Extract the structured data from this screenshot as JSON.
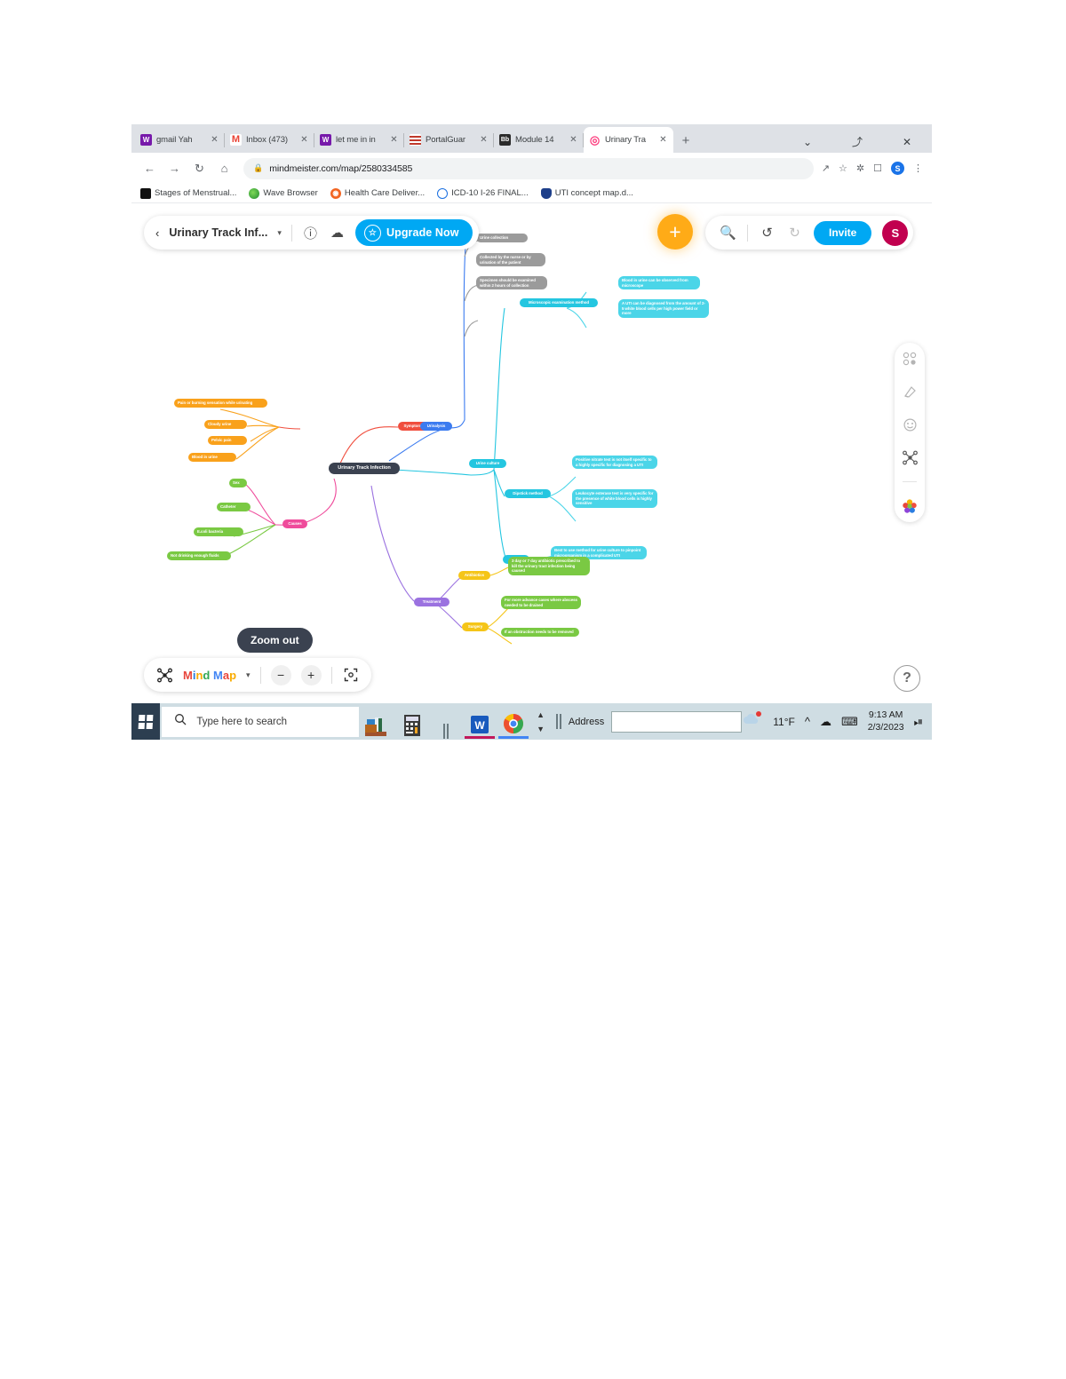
{
  "browser": {
    "tabs": [
      {
        "title": "gmail  Yah",
        "favicon": "w-icon",
        "active": false
      },
      {
        "title": "Inbox (473)",
        "favicon": "gmail-icon",
        "active": false
      },
      {
        "title": "let me in in",
        "favicon": "w-icon",
        "active": false
      },
      {
        "title": "PortalGuar",
        "favicon": "grid-icon",
        "active": false
      },
      {
        "title": "Module 14",
        "favicon": "blackboard-icon",
        "active": false
      },
      {
        "title": "Urinary Tra",
        "favicon": "mindmeister-icon",
        "active": true
      }
    ],
    "new_tab_label": "+",
    "tabstrip_buttons": [
      "⌄",
      "⤴",
      "✕"
    ],
    "omnibox": {
      "url": "mindmeister.com/map/2580334585",
      "lock_icon": "lock-icon",
      "back_icon": "←",
      "forward_icon": "→",
      "reload_icon": "↻",
      "home_icon": "⌂",
      "right_icons": [
        "share-icon",
        "star-icon",
        "extensions-icon",
        "sidepanel-icon"
      ],
      "profile_initial": "S",
      "menu_icon": "⋮"
    },
    "bookmarks": [
      {
        "label": "Stages of Menstrual...",
        "icon": "dark-icon"
      },
      {
        "label": "Wave Browser",
        "icon": "green-globe-icon"
      },
      {
        "label": "Health Care Deliver...",
        "icon": "orange-icon"
      },
      {
        "label": "ICD-10 I-26 FINAL...",
        "icon": "blue-icon"
      },
      {
        "label": "UTI concept map.d...",
        "icon": "shield-icon"
      }
    ]
  },
  "app": {
    "toolbar": {
      "back_icon": "‹",
      "map_title": "Urinary Track Inf...",
      "caret": "▾",
      "info_icon": "ⓘ",
      "export_icon": "export-cloud-icon",
      "upgrade_label": "Upgrade Now",
      "star_icon": "☆",
      "add_label": "+",
      "search_icon": "⚲",
      "undo_icon": "↺",
      "redo_icon": "↻",
      "invite_label": "Invite",
      "avatar_initial": "S"
    },
    "sidebar_icons": [
      "layout-icon",
      "style-icon",
      "emoji-icon",
      "mindmap-icon",
      "themes-icon"
    ],
    "bottom_bar": {
      "mode_icon": "mindmap-icon",
      "mode_label": "Mind Map",
      "caret": "▾",
      "zoom_out_label": "−",
      "zoom_in_label": "+",
      "fit_icon": "fit-screen-icon",
      "tooltip": "Zoom out"
    },
    "help_label": "?"
  },
  "mindmap": {
    "root": "Urinary Track Infection",
    "branches": [
      {
        "label": "Symptoms",
        "color": "#f04e3e",
        "children": [
          "Pain or burning sensation while urinating",
          "Cloudy urine",
          "Pelvic pain",
          "Blood in urine"
        ]
      },
      {
        "label": "Causes",
        "color": "#ef4b9b",
        "children": [
          "Sex",
          "Catheter",
          "E.coli bacteria",
          "Not drinking enough fluids"
        ]
      },
      {
        "label": "Urinalysis",
        "color": "#3b7bf0",
        "children": [
          "Urine collection",
          "Collected by the nurse or by urination of the patient",
          "Specimen should be examined within 2 hours of collection"
        ]
      },
      {
        "label": "Urine culture",
        "color": "#24c6e0",
        "children": [
          {
            "label": "Microscopic examination method",
            "children": [
              "Blood in urine can be observed from microscope",
              "A UTI can be diagnosed from the amount of 2-5 white blood cells per high power field or more"
            ]
          },
          {
            "label": "Dipstick method",
            "children": [
              "Positive nitrate test is not itself specific to a highly specific for diagnosing a UTI",
              "Leukocyte esterase test is very specific for the presence of white blood cells is highly sensitive"
            ]
          },
          {
            "label": "C & S",
            "children": [
              "Best to use method for urine culture to pinpoint microorganism in a complicated UTI"
            ]
          }
        ]
      },
      {
        "label": "Treatment",
        "color": "#9b72e0",
        "children": [
          {
            "label": "Antibiotics",
            "children": [
              "3 day or 7 day antibiotic prescribed to kill the urinary tract infection being caused"
            ]
          },
          {
            "label": "Surgery",
            "children": [
              "For more advance cases where abscess needed to be drained",
              "If an obstruction needs to be removed"
            ]
          }
        ]
      }
    ]
  },
  "taskbar": {
    "start_icon": "windows-icon",
    "search_placeholder": "Type here to search",
    "search_icon": "search-icon",
    "apps": [
      "files-icon",
      "calculator-icon",
      "pause-icon",
      "word-icon",
      "chrome-icon"
    ],
    "address_label": "Address",
    "address_value": "",
    "weather_icon": "cloud-icon",
    "temperature": "11°F",
    "tray_icons": [
      "show-hidden-icon",
      "onedrive-icon",
      "keyboard-icon"
    ],
    "time": "9:13 AM",
    "date": "2/3/2023",
    "action_center_icon": "notification-icon"
  }
}
